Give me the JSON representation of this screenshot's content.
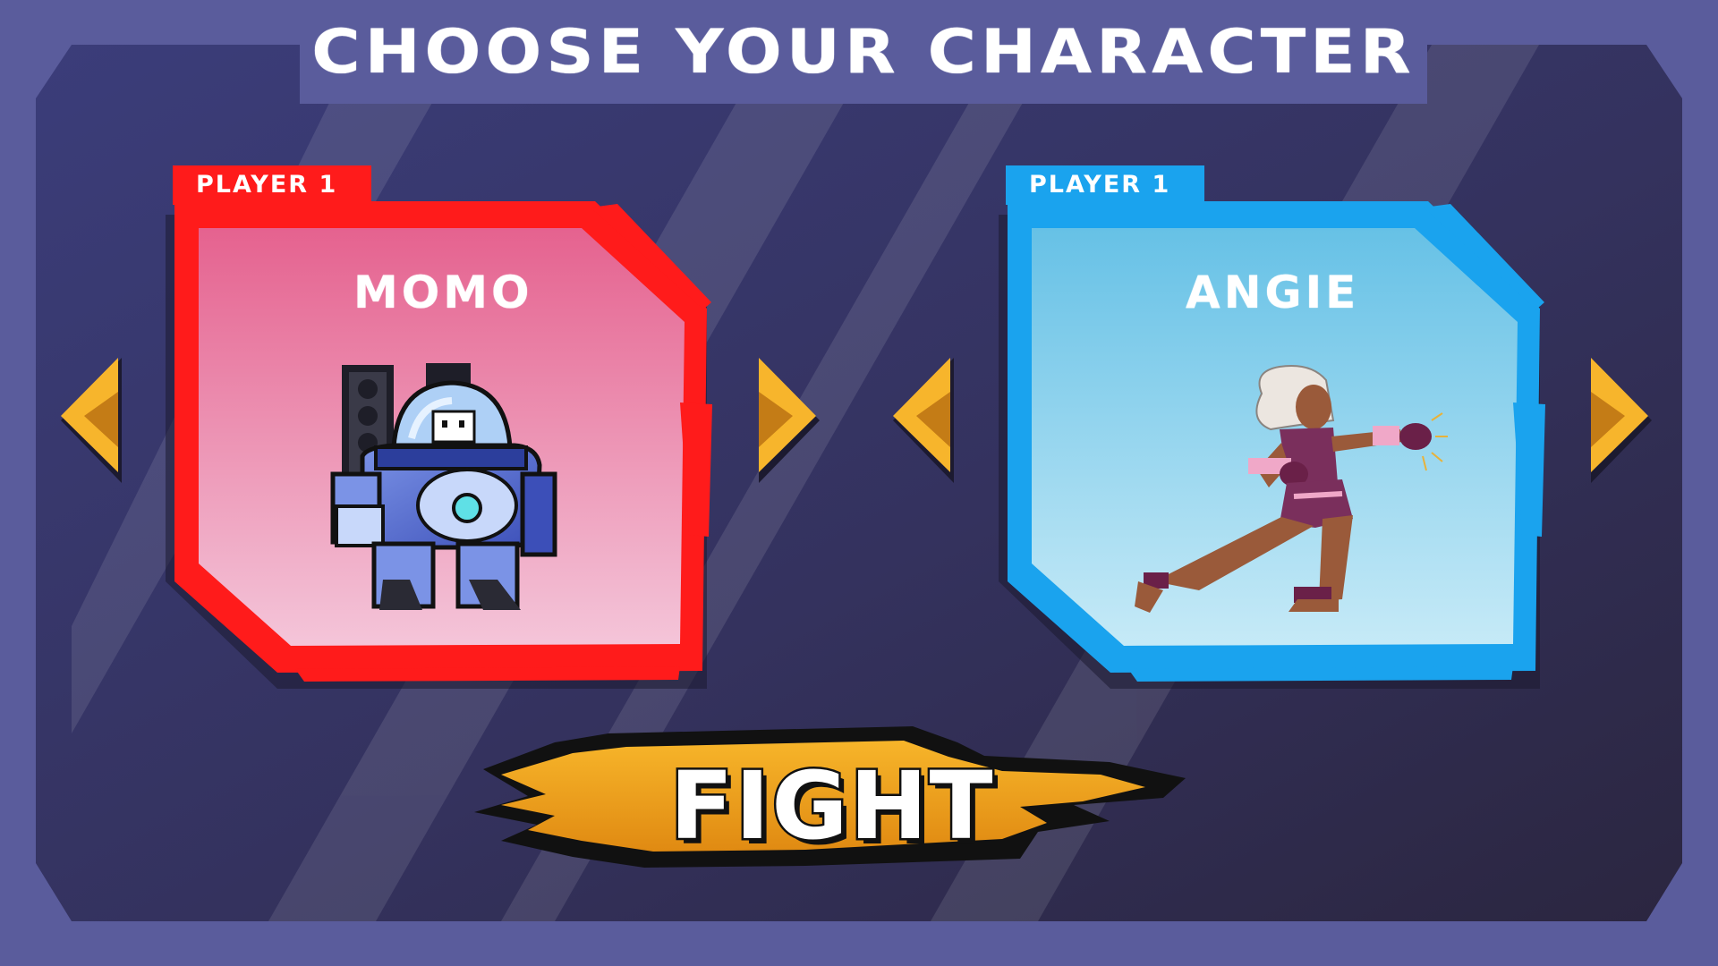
{
  "title": "CHOOSE YOUR CHARACTER",
  "player_left": {
    "tag": "PLAYER 1",
    "character_name": "MOMO",
    "frame_color": "#ff1b1b",
    "card_gradient": [
      "#e66a98",
      "#f4c3d8"
    ]
  },
  "player_right": {
    "tag": "PLAYER 1",
    "character_name": "ANGIE",
    "frame_color": "#1aa3ee",
    "card_gradient": [
      "#6ec7e8",
      "#c3e9f6"
    ]
  },
  "fight_button": {
    "label": "FIGHT",
    "splat_color": "#f2a01e"
  },
  "arrows": {
    "color": "#f7b52c",
    "shade": "#c47c16"
  },
  "icons": [
    "arrow-left-icon",
    "arrow-right-icon"
  ]
}
